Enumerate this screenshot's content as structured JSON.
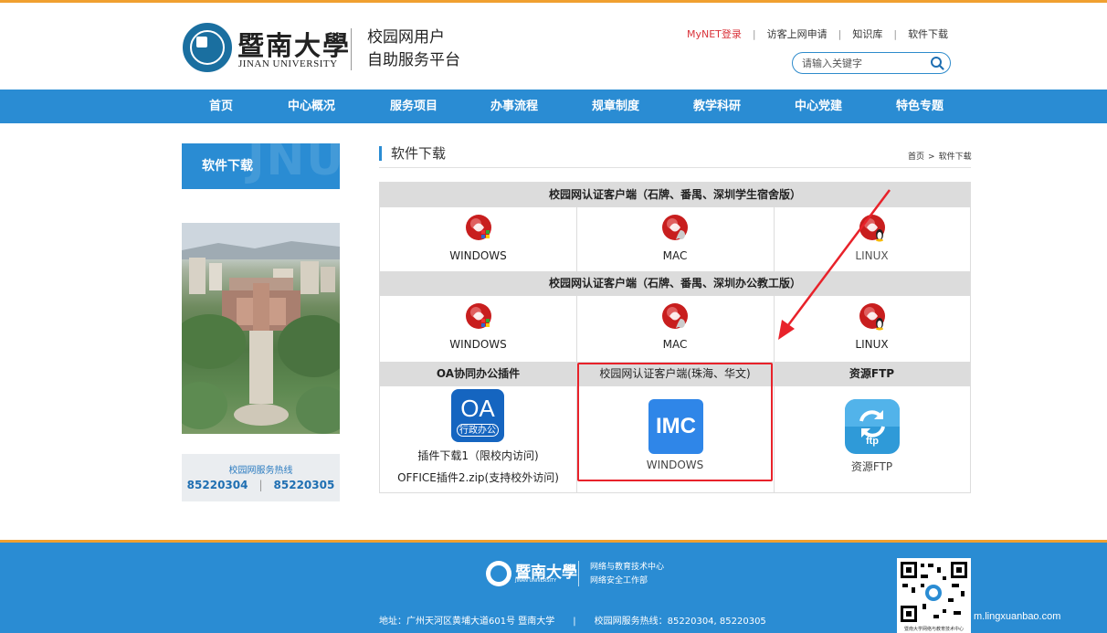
{
  "header": {
    "logo_cn": "暨南大學",
    "logo_en": "JINAN UNIVERSITY",
    "platform_line1": "校园网用户",
    "platform_line2": "自助服务平台",
    "links": {
      "mynet": "MyNET登录",
      "guest": "访客上网申请",
      "kb": "知识库",
      "download": "软件下载"
    },
    "search_placeholder": "请输入关键字"
  },
  "nav": [
    "首页",
    "中心概况",
    "服务项目",
    "办事流程",
    "规章制度",
    "教学科研",
    "中心党建",
    "特色专题"
  ],
  "sidebar": {
    "title": "软件下载",
    "ghost": "JNU",
    "hotline_title": "校园网服务热线",
    "hotline_1": "85220304",
    "hotline_2": "85220305"
  },
  "main": {
    "title": "软件下载",
    "breadcrumb_home": "首页",
    "breadcrumb_arrow": ">",
    "breadcrumb_current": "软件下载",
    "section1": {
      "title": "校园网认证客户端（石牌、番禺、深圳学生宿舍版）",
      "items": [
        "WINDOWS",
        "MAC",
        "LINUX"
      ]
    },
    "section2": {
      "title": "校园网认证客户端（石牌、番禺、深圳办公教工版）",
      "items": [
        "WINDOWS",
        "MAC",
        "LINUX"
      ]
    },
    "section3": {
      "oa_title": "OA协同办公插件",
      "oa_icon_big": "OA",
      "oa_icon_small": "行政办公",
      "oa_link1": "插件下载1（限校内访问)",
      "oa_link2": "OFFICE插件2.zip(支持校外访问)",
      "imc_title": "校园网认证客户端(珠海、华文)",
      "imc_icon": "IMC",
      "imc_label": "WINDOWS",
      "ftp_title": "资源FTP",
      "ftp_icon": "ftp",
      "ftp_label": "资源FTP"
    }
  },
  "footer": {
    "logo_cn": "暨南大學",
    "logo_en": "JINAN UNIVERSITY",
    "dept1": "网络与教育技术中心",
    "dept2": "网络安全工作部",
    "address": "地址：广州天河区黄埔大道601号 暨南大学",
    "addr_sep": "|",
    "hotline": "校园网服务热线：85220304, 85220305",
    "qr_caption": "暨南大学网络与教育技术中心",
    "watermark": "m.lingxuanbao.com"
  },
  "colors": {
    "brand_blue": "#2a8cd3",
    "accent_orange": "#f0a030",
    "annotation_red": "#e8222a"
  }
}
